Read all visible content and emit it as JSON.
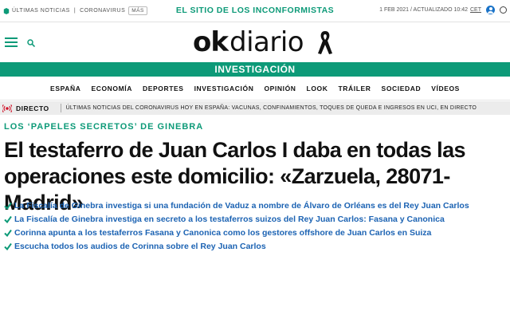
{
  "topbar": {
    "left_items": [
      "ÚLTIMAS NOTICIAS",
      "CORONAVIRUS"
    ],
    "more_label": "MÁS",
    "center_text": "EL SITIO DE LOS INCONFORMISTAS",
    "date_text": "1 FEB 2021 / ACTUALIZADO 10:42",
    "timezone": "CET"
  },
  "logo": {
    "ok_text": "ok",
    "diario_text": "diario"
  },
  "section": {
    "label": "INVESTIGACIÓN"
  },
  "nav": {
    "items": [
      "ESPAÑA",
      "ECONOMÍA",
      "DEPORTES",
      "INVESTIGACIÓN",
      "OPINIÓN",
      "LOOK",
      "TRÁILER",
      "SOCIEDAD",
      "VÍDEOS"
    ]
  },
  "breaking": {
    "label": "DIRECTO",
    "text": "ÚLTIMAS NOTICIAS DEL CORONAVIRUS HOY EN ESPAÑA: VACUNAS, CONFINAMIENTOS, TOQUES DE QUEDA E INGRESOS EN UCI, EN DIRECTO"
  },
  "article": {
    "kicker": "LOS ‘PAPELES SECRETOS’ DE GINEBRA",
    "headline": "El testaferro de Juan Carlos I daba en todas las operaciones este domicilio: «Zarzuela, 28071-Madrid»",
    "related": [
      "La Fiscalía de Ginebra investiga si una fundación de Vaduz a nombre de Álvaro de Orléans es del Rey Juan Carlos",
      "La Fiscalía de Ginebra investiga en secreto a los testaferros suizos del Rey Juan Carlos: Fasana y Canonica",
      "Corinna apunta a los testaferros Fasana y Canonica como los gestores offshore de Juan Carlos en Suiza",
      "Escucha todos los audios de Corinna sobre el Rey Juan Carlos"
    ]
  },
  "colors": {
    "brand_green": "#0d9a78",
    "link_blue": "#1c63b3",
    "live_red": "#d0152b"
  },
  "icons": [
    "news-icon",
    "user-icon",
    "search-icon",
    "menu-icon",
    "mourning-ribbon-icon",
    "live-icon",
    "check-icon"
  ]
}
